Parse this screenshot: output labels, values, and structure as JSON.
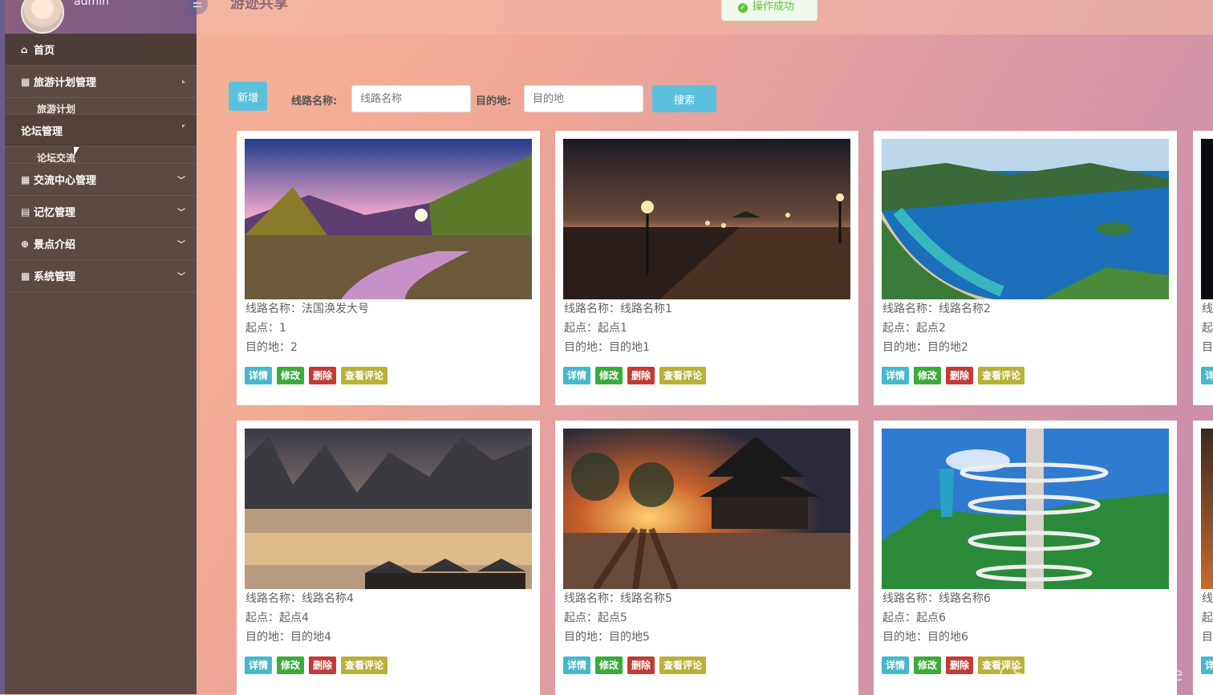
{
  "header": {
    "title": "游迹共享",
    "user": "admin",
    "toast": "操作成功"
  },
  "sidebar": {
    "items": [
      {
        "label": "首页",
        "icon": "home-icon",
        "glyph": "⌂"
      },
      {
        "label": "旅游计划管理",
        "icon": "grid-icon",
        "glyph": "▦",
        "sub": "旅游计划"
      },
      {
        "label": "论坛管理",
        "icon": "forum-icon",
        "glyph": "",
        "sub": "论坛交流"
      },
      {
        "label": "交流中心管理",
        "icon": "grid-icon",
        "glyph": "▦"
      },
      {
        "label": "记忆管理",
        "icon": "book-icon",
        "glyph": "▤"
      },
      {
        "label": "景点介绍",
        "icon": "globe-icon",
        "glyph": "⊕"
      },
      {
        "label": "系统管理",
        "icon": "windows-icon",
        "glyph": "▦"
      }
    ]
  },
  "search": {
    "add_label": "新增",
    "route_label": "线路名称:",
    "route_placeholder": "线路名称",
    "dest_label": "目的地:",
    "dest_placeholder": "目的地",
    "search_label": "搜索"
  },
  "actions": {
    "detail": "详情",
    "edit": "修改",
    "delete": "删除",
    "comments": "查看评论"
  },
  "cards": [
    {
      "line1": "线路名称：法国涣发大号",
      "line2": "起点：1",
      "line3": "目的地：2",
      "img": "autumn-river-sunset-image"
    },
    {
      "line1": "线路名称：线路名称1",
      "line2": "起点：起点1",
      "line3": "目的地：目的地1",
      "img": "pier-night-image"
    },
    {
      "line1": "线路名称：线路名称2",
      "line2": "起点：起点2",
      "line3": "目的地：目的地2",
      "img": "bay-coast-image"
    },
    {
      "line1": "线路名称：线路名称4",
      "line2": "起点：起点4",
      "line3": "目的地：目的地4",
      "img": "karst-river-image"
    },
    {
      "line1": "线路名称：线路名称5",
      "line2": "起点：起点5",
      "line3": "目的地：目的地5",
      "img": "pavilion-sunset-image"
    },
    {
      "line1": "线路名称：线路名称6",
      "line2": "起点：起点6",
      "line3": "目的地：目的地6",
      "img": "spiral-tower-image"
    }
  ],
  "partial_card": {
    "line1": "线",
    "line2": "起",
    "line3": "目",
    "detail": "详"
  },
  "watermark": "CSDN @程序员code"
}
